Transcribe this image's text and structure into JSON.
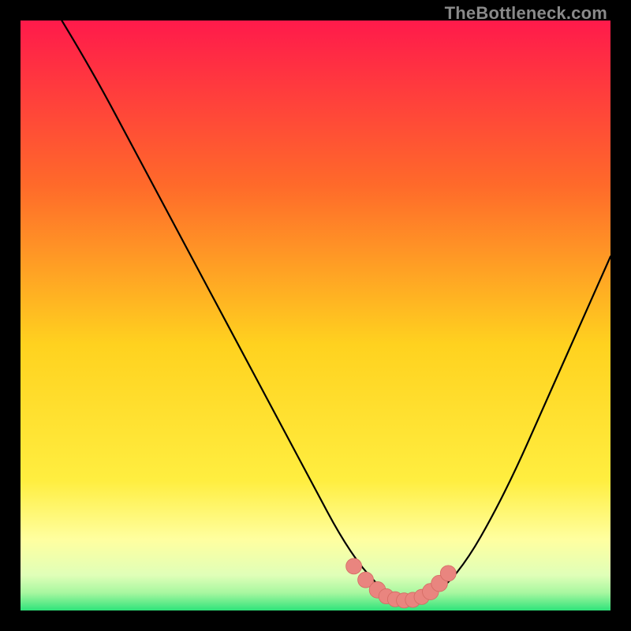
{
  "watermark": "TheBottleneck.com",
  "colors": {
    "gradient_top": "#ff1a4b",
    "gradient_upper_mid": "#ff7a2a",
    "gradient_mid": "#ffd21f",
    "gradient_lower_mid": "#ffff55",
    "gradient_low": "#e8ffb0",
    "gradient_bottom": "#2fe37a",
    "curve": "#000000",
    "marker_fill": "#e9857f",
    "marker_stroke": "#d46a63",
    "frame_bg": "#000000"
  },
  "chart_data": {
    "type": "line",
    "title": "",
    "xlabel": "",
    "ylabel": "",
    "xlim": [
      0,
      100
    ],
    "ylim": [
      0,
      100
    ],
    "grid": false,
    "legend": false,
    "series": [
      {
        "name": "bottleneck-curve",
        "x": [
          7,
          10,
          14,
          18,
          22,
          26,
          30,
          34,
          38,
          42,
          46,
          50,
          54,
          58,
          62,
          64,
          66,
          68,
          72,
          76,
          80,
          84,
          88,
          92,
          96,
          100
        ],
        "y": [
          100,
          95,
          88,
          80.5,
          73,
          65.5,
          58,
          50.5,
          43,
          35.5,
          28,
          20.5,
          13,
          7,
          3,
          2,
          1.5,
          2,
          4,
          9,
          16,
          24,
          33,
          42,
          51,
          60
        ]
      }
    ],
    "markers": [
      {
        "x": 56.5,
        "y": 7.5,
        "r": 1.6
      },
      {
        "x": 58.5,
        "y": 5.2,
        "r": 1.6
      },
      {
        "x": 60.5,
        "y": 3.5,
        "r": 1.7
      },
      {
        "x": 62,
        "y": 2.4,
        "r": 1.5
      },
      {
        "x": 63.5,
        "y": 1.9,
        "r": 1.5
      },
      {
        "x": 65,
        "y": 1.7,
        "r": 1.5
      },
      {
        "x": 66.5,
        "y": 1.8,
        "r": 1.5
      },
      {
        "x": 68,
        "y": 2.3,
        "r": 1.5
      },
      {
        "x": 69.5,
        "y": 3.2,
        "r": 1.7
      },
      {
        "x": 71,
        "y": 4.6,
        "r": 1.7
      },
      {
        "x": 72.5,
        "y": 6.3,
        "r": 1.6
      }
    ]
  }
}
